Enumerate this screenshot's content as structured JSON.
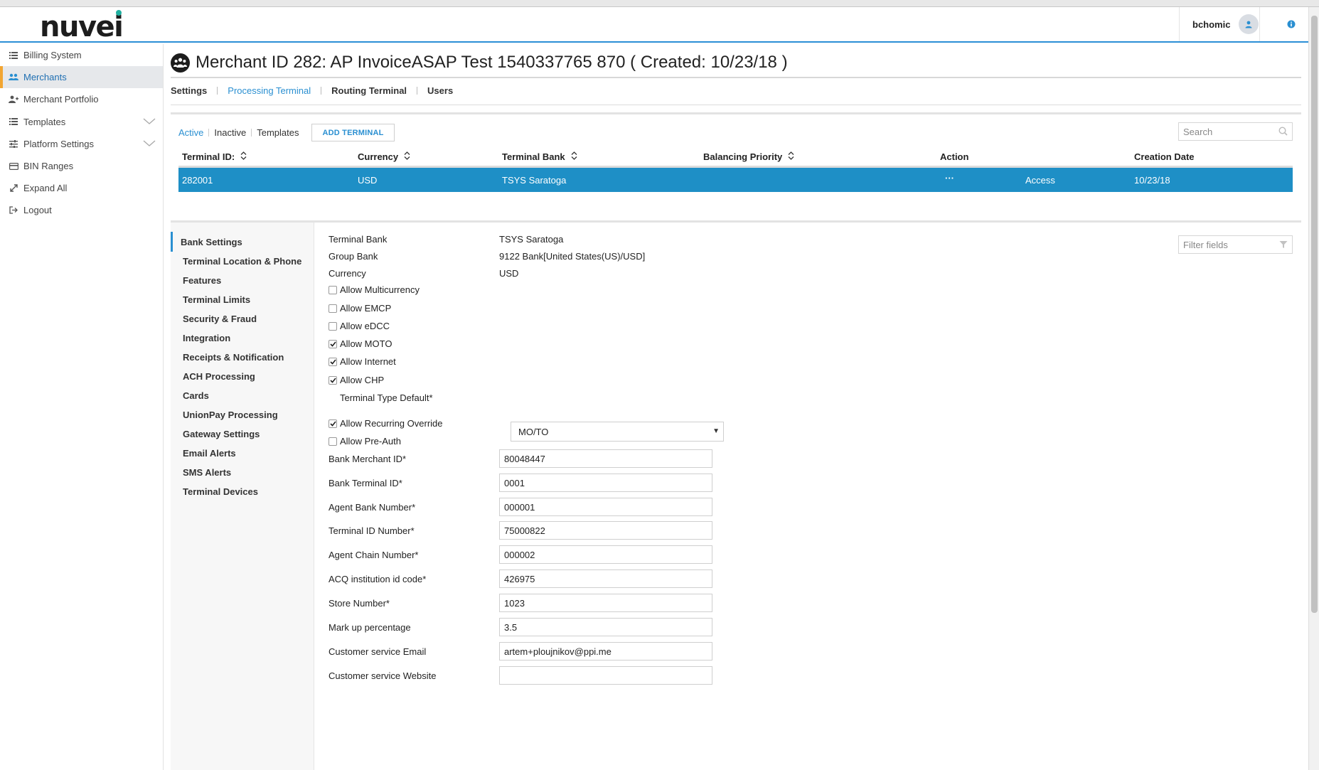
{
  "header": {
    "logo_text": "nuvei",
    "user_name": "bchomic"
  },
  "sidebar": {
    "items": [
      {
        "label": "Billing System",
        "icon": "list-icon"
      },
      {
        "label": "Merchants",
        "icon": "users-icon"
      },
      {
        "label": "Merchant Portfolio",
        "icon": "user-add-icon"
      },
      {
        "label": "Templates",
        "icon": "list-icon"
      },
      {
        "label": "Platform Settings",
        "icon": "sliders-icon"
      },
      {
        "label": "BIN Ranges",
        "icon": "card-icon"
      },
      {
        "label": "Expand All",
        "icon": "expand-icon"
      },
      {
        "label": "Logout",
        "icon": "logout-icon"
      }
    ]
  },
  "page": {
    "title": "Merchant ID 282: AP InvoiceASAP Test 1540337765 870 ( Created: 10/23/18 )",
    "tabs": [
      "Settings",
      "Processing Terminal",
      "Routing Terminal",
      "Users"
    ]
  },
  "terminals": {
    "filters": [
      "Active",
      "Inactive",
      "Templates"
    ],
    "add_button": "ADD TERMINAL",
    "search_placeholder": "Search",
    "columns": [
      "Terminal ID:",
      "Currency",
      "Terminal Bank",
      "Balancing Priority",
      "Action",
      "Creation Date"
    ],
    "row": {
      "terminal_id": "282001",
      "currency": "USD",
      "terminal_bank": "TSYS Saratoga",
      "action_menu": "···",
      "access": "Access",
      "creation_date": "10/23/18"
    }
  },
  "detail_nav": [
    "Bank Settings",
    "Terminal Location & Phone",
    "Features",
    "Terminal Limits",
    "Security & Fraud",
    "Integration",
    "Receipts & Notification",
    "ACH Processing",
    "Cards",
    "UnionPay Processing",
    "Gateway Settings",
    "Email Alerts",
    "SMS Alerts",
    "Terminal Devices"
  ],
  "bank_settings": {
    "filter_placeholder": "Filter fields",
    "terminal_bank_label": "Terminal Bank",
    "terminal_bank_value": "TSYS Saratoga",
    "group_bank_label": "Group Bank",
    "group_bank_value": "9122 Bank[United States(US)/USD]",
    "currency_label": "Currency",
    "currency_value": "USD",
    "checkboxes": [
      {
        "label": "Allow Multicurrency",
        "checked": false
      },
      {
        "label": "Allow EMCP",
        "checked": false
      },
      {
        "label": "Allow eDCC",
        "checked": false
      },
      {
        "label": "Allow MOTO",
        "checked": true
      },
      {
        "label": "Allow Internet",
        "checked": true
      },
      {
        "label": "Allow CHP",
        "checked": true
      }
    ],
    "terminal_type_label": "Terminal Type Default*",
    "terminal_type_value": "MO/TO",
    "checkboxes2": [
      {
        "label": "Allow Recurring Override",
        "checked": true
      },
      {
        "label": "Allow Pre-Auth",
        "checked": false
      }
    ],
    "inputs": [
      {
        "label": "Bank Merchant ID*",
        "value": "80048447"
      },
      {
        "label": "Bank Terminal ID*",
        "value": "0001"
      },
      {
        "label": "Agent Bank Number*",
        "value": "000001"
      },
      {
        "label": "Terminal ID Number*",
        "value": "75000822"
      },
      {
        "label": "Agent Chain Number*",
        "value": "000002"
      },
      {
        "label": "ACQ institution id code*",
        "value": "426975"
      },
      {
        "label": "Store Number*",
        "value": "1023"
      },
      {
        "label": "Mark up percentage",
        "value": "3.5"
      },
      {
        "label": "Customer service Email",
        "value": "artem+ploujnikov@ppi.me"
      },
      {
        "label": "Customer service Website",
        "value": ""
      }
    ]
  },
  "colors": {
    "accent": "#2a8fd1",
    "selected_row": "#1e8fc6",
    "active_marker": "#f2a531"
  }
}
